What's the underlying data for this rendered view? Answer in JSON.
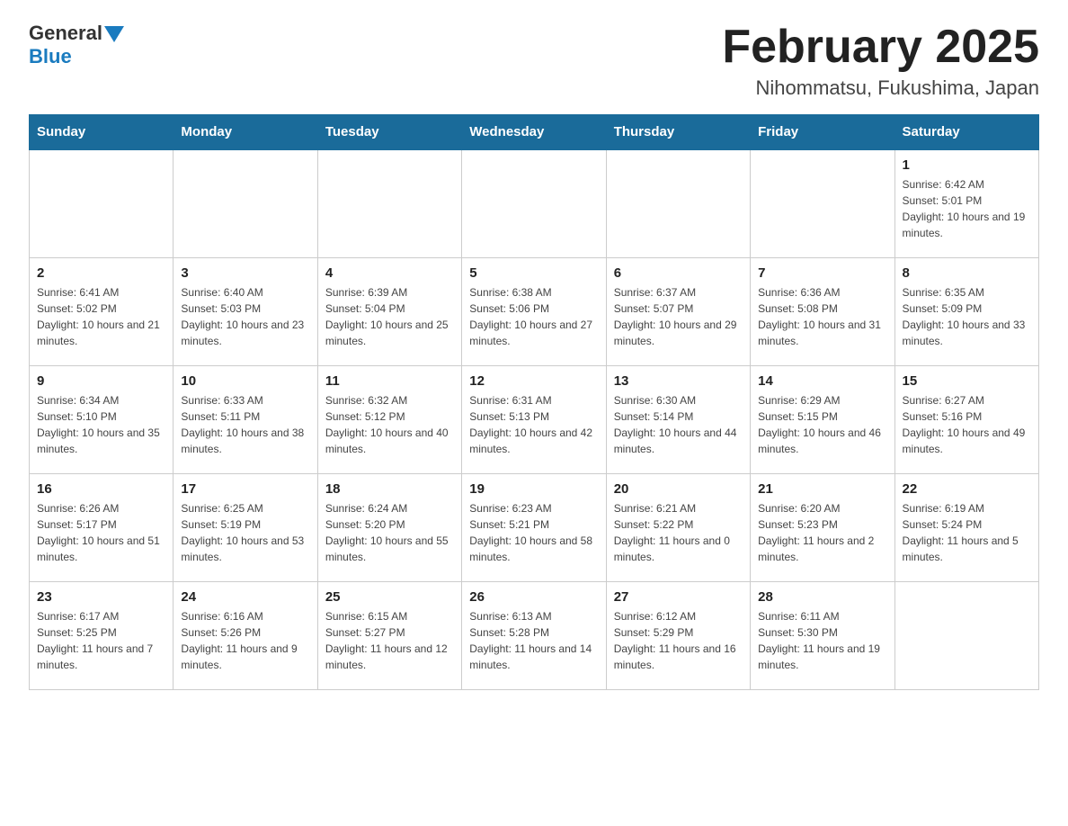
{
  "header": {
    "logo_line1": "General",
    "logo_arrow": true,
    "logo_line2": "Blue",
    "title": "February 2025",
    "subtitle": "Nihommatsu, Fukushima, Japan"
  },
  "days_of_week": [
    "Sunday",
    "Monday",
    "Tuesday",
    "Wednesday",
    "Thursday",
    "Friday",
    "Saturday"
  ],
  "weeks": [
    [
      {
        "day": "",
        "info": ""
      },
      {
        "day": "",
        "info": ""
      },
      {
        "day": "",
        "info": ""
      },
      {
        "day": "",
        "info": ""
      },
      {
        "day": "",
        "info": ""
      },
      {
        "day": "",
        "info": ""
      },
      {
        "day": "1",
        "info": "Sunrise: 6:42 AM\nSunset: 5:01 PM\nDaylight: 10 hours and 19 minutes."
      }
    ],
    [
      {
        "day": "2",
        "info": "Sunrise: 6:41 AM\nSunset: 5:02 PM\nDaylight: 10 hours and 21 minutes."
      },
      {
        "day": "3",
        "info": "Sunrise: 6:40 AM\nSunset: 5:03 PM\nDaylight: 10 hours and 23 minutes."
      },
      {
        "day": "4",
        "info": "Sunrise: 6:39 AM\nSunset: 5:04 PM\nDaylight: 10 hours and 25 minutes."
      },
      {
        "day": "5",
        "info": "Sunrise: 6:38 AM\nSunset: 5:06 PM\nDaylight: 10 hours and 27 minutes."
      },
      {
        "day": "6",
        "info": "Sunrise: 6:37 AM\nSunset: 5:07 PM\nDaylight: 10 hours and 29 minutes."
      },
      {
        "day": "7",
        "info": "Sunrise: 6:36 AM\nSunset: 5:08 PM\nDaylight: 10 hours and 31 minutes."
      },
      {
        "day": "8",
        "info": "Sunrise: 6:35 AM\nSunset: 5:09 PM\nDaylight: 10 hours and 33 minutes."
      }
    ],
    [
      {
        "day": "9",
        "info": "Sunrise: 6:34 AM\nSunset: 5:10 PM\nDaylight: 10 hours and 35 minutes."
      },
      {
        "day": "10",
        "info": "Sunrise: 6:33 AM\nSunset: 5:11 PM\nDaylight: 10 hours and 38 minutes."
      },
      {
        "day": "11",
        "info": "Sunrise: 6:32 AM\nSunset: 5:12 PM\nDaylight: 10 hours and 40 minutes."
      },
      {
        "day": "12",
        "info": "Sunrise: 6:31 AM\nSunset: 5:13 PM\nDaylight: 10 hours and 42 minutes."
      },
      {
        "day": "13",
        "info": "Sunrise: 6:30 AM\nSunset: 5:14 PM\nDaylight: 10 hours and 44 minutes."
      },
      {
        "day": "14",
        "info": "Sunrise: 6:29 AM\nSunset: 5:15 PM\nDaylight: 10 hours and 46 minutes."
      },
      {
        "day": "15",
        "info": "Sunrise: 6:27 AM\nSunset: 5:16 PM\nDaylight: 10 hours and 49 minutes."
      }
    ],
    [
      {
        "day": "16",
        "info": "Sunrise: 6:26 AM\nSunset: 5:17 PM\nDaylight: 10 hours and 51 minutes."
      },
      {
        "day": "17",
        "info": "Sunrise: 6:25 AM\nSunset: 5:19 PM\nDaylight: 10 hours and 53 minutes."
      },
      {
        "day": "18",
        "info": "Sunrise: 6:24 AM\nSunset: 5:20 PM\nDaylight: 10 hours and 55 minutes."
      },
      {
        "day": "19",
        "info": "Sunrise: 6:23 AM\nSunset: 5:21 PM\nDaylight: 10 hours and 58 minutes."
      },
      {
        "day": "20",
        "info": "Sunrise: 6:21 AM\nSunset: 5:22 PM\nDaylight: 11 hours and 0 minutes."
      },
      {
        "day": "21",
        "info": "Sunrise: 6:20 AM\nSunset: 5:23 PM\nDaylight: 11 hours and 2 minutes."
      },
      {
        "day": "22",
        "info": "Sunrise: 6:19 AM\nSunset: 5:24 PM\nDaylight: 11 hours and 5 minutes."
      }
    ],
    [
      {
        "day": "23",
        "info": "Sunrise: 6:17 AM\nSunset: 5:25 PM\nDaylight: 11 hours and 7 minutes."
      },
      {
        "day": "24",
        "info": "Sunrise: 6:16 AM\nSunset: 5:26 PM\nDaylight: 11 hours and 9 minutes."
      },
      {
        "day": "25",
        "info": "Sunrise: 6:15 AM\nSunset: 5:27 PM\nDaylight: 11 hours and 12 minutes."
      },
      {
        "day": "26",
        "info": "Sunrise: 6:13 AM\nSunset: 5:28 PM\nDaylight: 11 hours and 14 minutes."
      },
      {
        "day": "27",
        "info": "Sunrise: 6:12 AM\nSunset: 5:29 PM\nDaylight: 11 hours and 16 minutes."
      },
      {
        "day": "28",
        "info": "Sunrise: 6:11 AM\nSunset: 5:30 PM\nDaylight: 11 hours and 19 minutes."
      },
      {
        "day": "",
        "info": ""
      }
    ]
  ]
}
